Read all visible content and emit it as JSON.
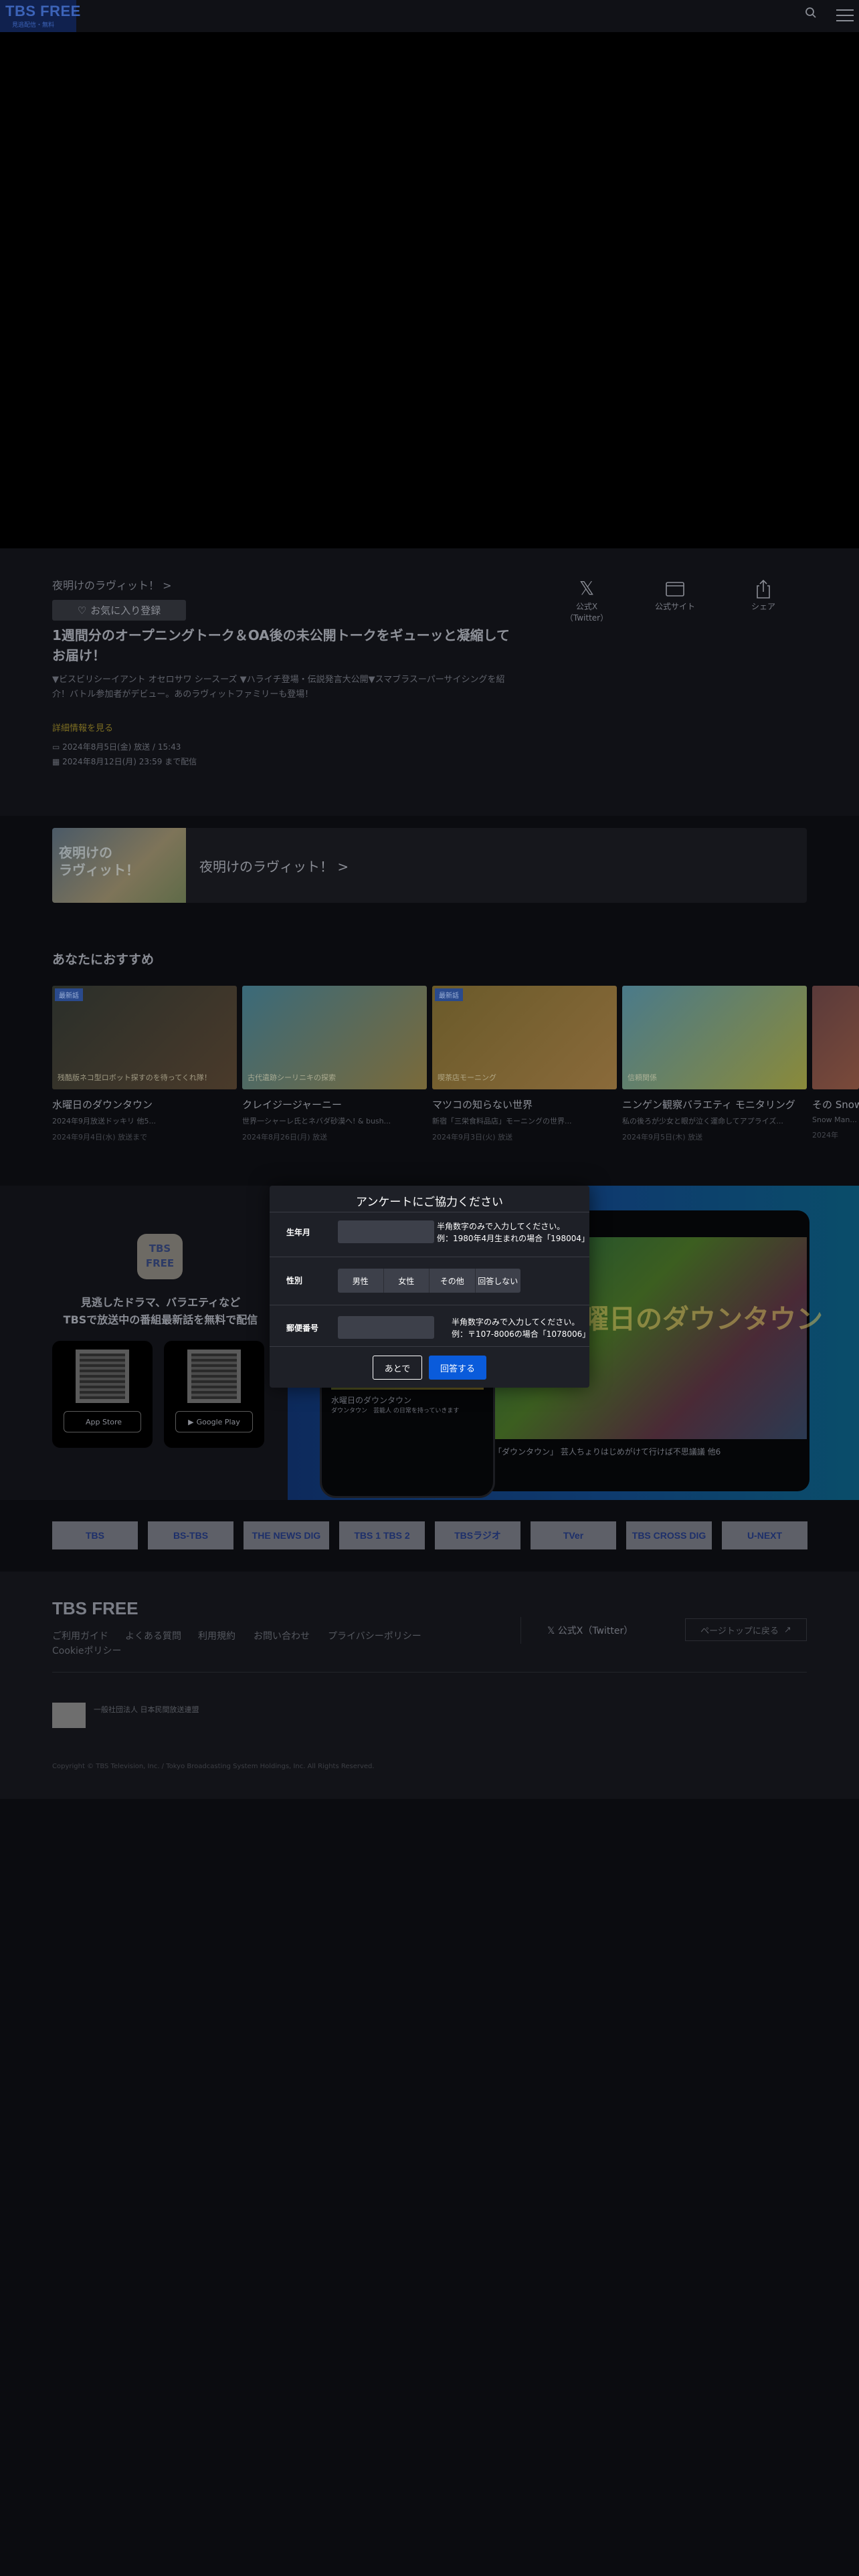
{
  "header": {
    "logo": "TBS FREE",
    "logo_sub": "見逃配信・無料",
    "search_icon": "search-icon",
    "menu_icon": "hamburger-menu-icon"
  },
  "program": {
    "breadcrumb": "夜明けのラヴィット！ >",
    "favorite_button": "お気に入り登録",
    "title": "1週間分のオープニングトーク＆OA後の未公開トークをギューッと凝縮してお届け！",
    "description": "▼ビスビリシーイアント オセロサワ シースーズ ▼ハライチ登場・伝説発言大公開▼スマブラスーパーサイシングを紹介！バトル参加者がデビュー。あのラヴィットファミリーも登場！",
    "more_link": "詳細情報を見る",
    "meta_broadcast": "2024年8月5日(金) 放送 / 15:43",
    "meta_until": "2024年8月12日(月) 23:59 まで配信"
  },
  "share": [
    {
      "icon": "x-logo-icon",
      "label": "公式X（Twitter）"
    },
    {
      "icon": "browser-window-icon",
      "label": "公式サイト"
    },
    {
      "icon": "share-icon",
      "label": "シェア"
    }
  ],
  "banner": {
    "image_text": "夜明けの\nラヴィット！",
    "label": "夜明けのラヴィット！ >"
  },
  "recommend": {
    "title": "あなたにおすすめ",
    "cards": [
      {
        "badge": "最新話",
        "title": "水曜日のダウンタウン",
        "sub": "2024年9月放送ドッキリ 他5...",
        "date": "2024年9月4日(水) 放送まで",
        "thumb_text": "残酷版ネコ型ロボット探すのを待ってくれ隊！",
        "colors": [
          "#2a2f2a",
          "#4a3a2a"
        ]
      },
      {
        "badge": "",
        "title": "クレイジージャーニー",
        "sub": "世界一シャーレ氏とネバダ砂漠へ! & bush...",
        "date": "2024年8月26日(月) 放送",
        "thumb_text": "古代遺跡シーリニキの探索",
        "colors": [
          "#3a6a7a",
          "#7a6a3a"
        ]
      },
      {
        "badge": "最新話",
        "title": "マツコの知らない世界",
        "sub": "新宿「三栄食料品店」モーニングの世界...",
        "date": "2024年9月3日(火) 放送",
        "thumb_text": "喫茶店モーニング",
        "colors": [
          "#6a5a2a",
          "#8a6a3a"
        ]
      },
      {
        "badge": "",
        "title": "ニンゲン観察バラエティ モニタリング",
        "sub": "私の後ろが少女と眼が泣く運命してアプライズ...",
        "date": "2024年9月5日(木) 放送",
        "thumb_text": "信頼関係",
        "colors": [
          "#4a7a8a",
          "#8a8a3a"
        ]
      },
      {
        "badge": "",
        "title": "その Snow",
        "sub": "Snow Man...",
        "date": "2024年",
        "thumb_text": "",
        "colors": [
          "#5a3a3a",
          "#7a4a3a"
        ]
      }
    ]
  },
  "app_promo": {
    "logo_text": "TBS\nFREE",
    "text": "見逃したドラマ、バラエティなど\nTBSで放送中の番組最新話を無料で配信",
    "app_store": "App Store",
    "google_play": "Google Play",
    "phone_caption": "水曜日のダウンタウン",
    "phone_caption2": "ダウンタウン　芸能人 の日常を持っていきます",
    "phone_caption3": "「ダウンタウン」 芸人ちょりはじめがけて行けば不思議議 他6",
    "phone_image_text": "水曜日のダウンタウン"
  },
  "channels": [
    "TBS",
    "BS-TBS",
    "THE NEWS DIG",
    "TBS 1 TBS 2",
    "TBSラジオ",
    "TVer",
    "TBS CROSS DIG",
    "U-NEXT"
  ],
  "footer": {
    "logo": "TBS FREE",
    "links": [
      "ご利用ガイド",
      "よくある質問",
      "利用規約",
      "お問い合わせ",
      "プライバシーポリシー",
      "Cookieポリシー"
    ],
    "x_link": "公式X（Twitter）",
    "page_top": "ページトップに戻る",
    "badge_text": "一般社団法人 日本民間放送連盟",
    "copyright": "Copyright © TBS Television, Inc. / Tokyo Broadcasting System Holdings, Inc. All Rights Reserved."
  },
  "survey": {
    "title": "アンケートにご協力ください",
    "birth_label": "生年月",
    "birth_placeholder": "",
    "birth_note_1": "半角数字のみで入力してください。",
    "birth_note_2": "例：1980年4月生まれの場合「198004」",
    "gender_label": "性別",
    "gender_options": [
      "男性",
      "女性",
      "その他",
      "回答しない"
    ],
    "zip_label": "郵便番号",
    "zip_placeholder": "",
    "zip_note_1": "半角数字のみで入力してください。",
    "zip_note_2": "例：〒107-8006の場合「1078006」",
    "later_button": "あとで",
    "submit_button": "回答する"
  },
  "colors": {
    "accent": "#0a5bdb",
    "background": "#0b0c10",
    "modal": "#1e2027"
  }
}
